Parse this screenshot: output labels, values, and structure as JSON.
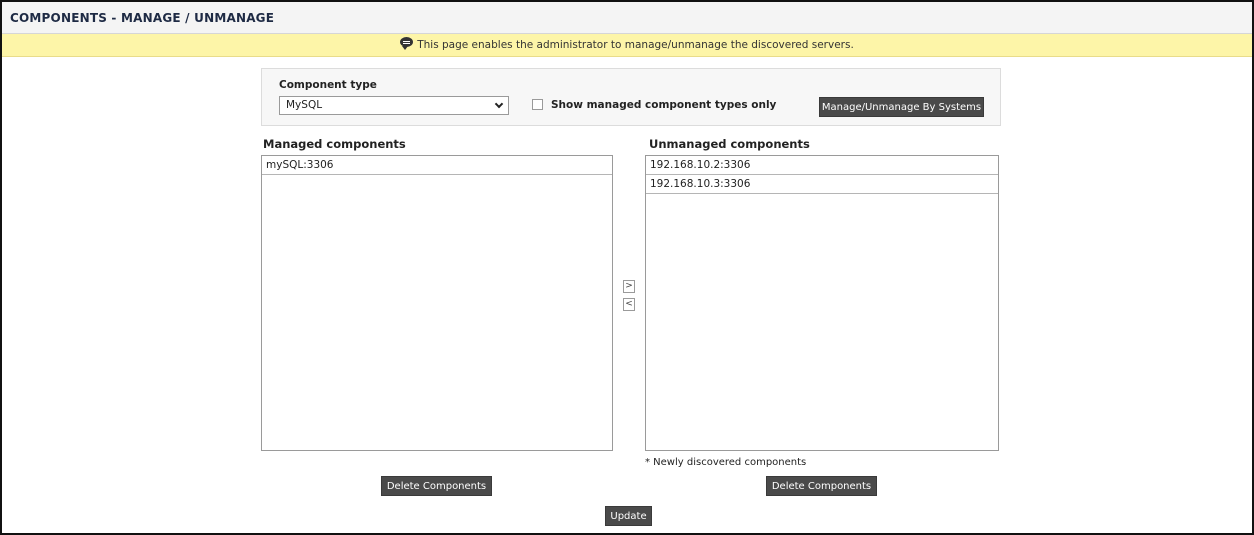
{
  "header": {
    "title": "COMPONENTS - MANAGE / UNMANAGE"
  },
  "info": {
    "icon": "speech-bubble-icon",
    "message": "This page enables the administrator to manage/unmanage the discovered servers."
  },
  "filter": {
    "component_type_label": "Component type",
    "component_type_value": "MySQL",
    "show_managed_only_label": "Show managed component types only",
    "show_managed_only_checked": false,
    "manage_by_systems_label": "Manage/Unmanage By Systems"
  },
  "managed": {
    "label": "Managed components",
    "items": [
      "mySQL:3306"
    ],
    "delete_label": "Delete Components"
  },
  "unmanaged": {
    "label": "Unmanaged components",
    "items": [
      "192.168.10.2:3306",
      "192.168.10.3:3306"
    ],
    "note": "* Newly discovered components",
    "delete_label": "Delete Components"
  },
  "transfer": {
    "move_right": ">",
    "move_left": "<"
  },
  "footer": {
    "update_label": "Update"
  }
}
